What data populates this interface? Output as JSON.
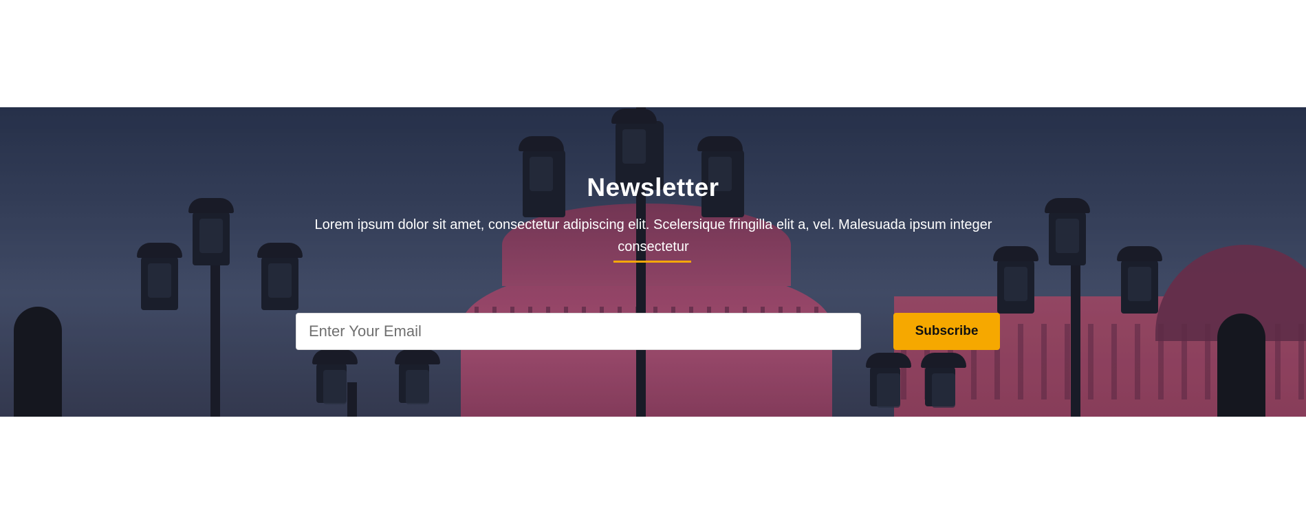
{
  "newsletter": {
    "title": "Newsletter",
    "description": "Lorem ipsum dolor sit amet, consectetur adipiscing elit. Scelersique fringilla elit a, vel. Malesuada ipsum integer consectetur",
    "email_placeholder": "Enter Your Email",
    "subscribe_label": "Subscribe"
  },
  "colors": {
    "accent": "#f6a800",
    "overlay": "#2a3550",
    "building": "#c2567c"
  }
}
